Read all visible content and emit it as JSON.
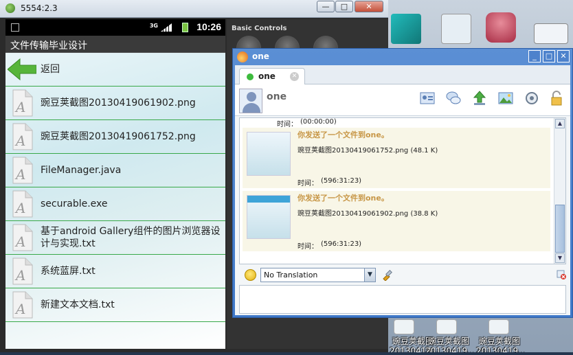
{
  "emulator": {
    "title": "5554:2.3",
    "window_buttons": {
      "minimize": "—",
      "maximize": "□",
      "close": "✕"
    }
  },
  "phone": {
    "status_time": "10:26",
    "network_label": "3G",
    "app_title": "文件传输毕业设计",
    "back_label": "返回",
    "files": [
      {
        "name": "豌豆荚截图20130419061902.png"
      },
      {
        "name": "豌豆荚截图20130419061752.png"
      },
      {
        "name": "FileManager.java"
      },
      {
        "name": "securable.exe"
      },
      {
        "name": "基于android Gallery组件的图片浏览器设计与实现.txt"
      },
      {
        "name": "系统蓝屏.txt"
      },
      {
        "name": "新建文本文档.txt"
      }
    ]
  },
  "controls_panel": {
    "label": "Basic Controls"
  },
  "chat": {
    "window_title": "one",
    "tab_name": "one",
    "contact_name": "one",
    "top_time_label": "时间：",
    "top_time_value": "(00:00:00)",
    "messages": [
      {
        "sent_text": "你发送了一个文件到one。",
        "file": "豌豆荚截图20130419061752.png (48.1 K)",
        "time_label": "时间：",
        "time_value": "(596:31:23)"
      },
      {
        "sent_text": "你发送了一个文件到one。",
        "file": "豌豆荚截图20130419061902.png (38.8 K)",
        "time_label": "时间：",
        "time_value": "(596:31:23)"
      }
    ],
    "translation_select": "No Translation"
  },
  "desktop": {
    "icons": [
      {
        "label": "豌豆荚截图"
      },
      {
        "label": "豌豆荚截图"
      },
      {
        "label": "豌豆荚截图"
      }
    ],
    "icon_sublabels": [
      "20130419...",
      "20130419...",
      "20130419..."
    ]
  },
  "colors": {
    "list_divider": "#37a848",
    "chat_frame": "#3f78c8",
    "sent_text": "#c79646"
  }
}
